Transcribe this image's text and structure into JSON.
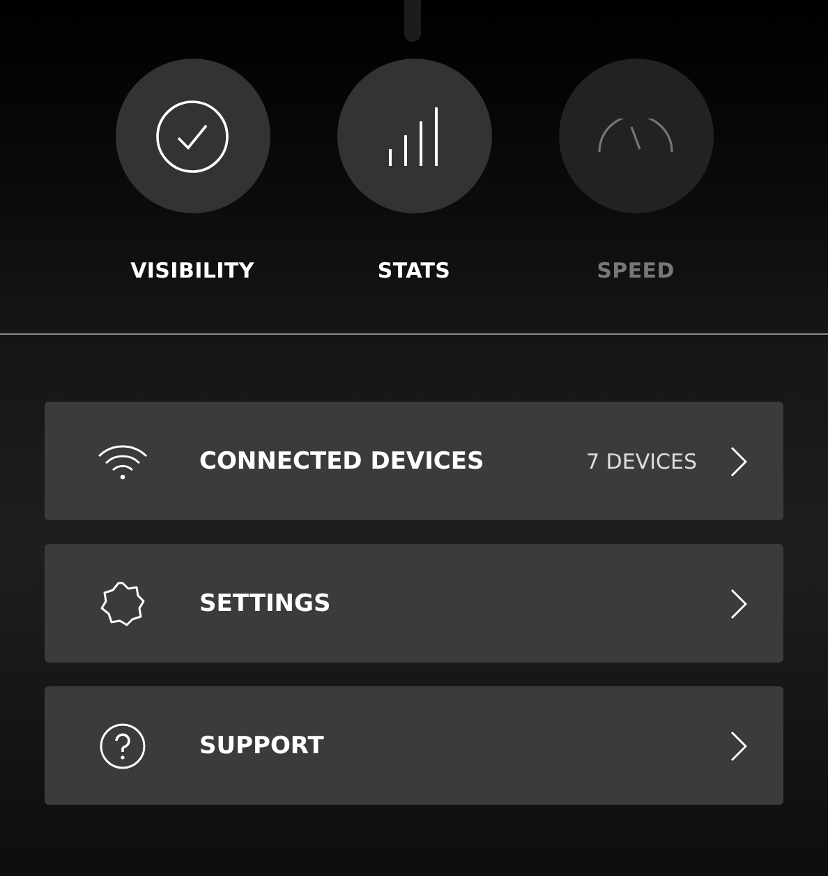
{
  "modes": [
    {
      "label": "VISIBILITY",
      "kind": "check",
      "disabled": false
    },
    {
      "label": "STATS",
      "kind": "bars",
      "disabled": false
    },
    {
      "label": "SPEED",
      "kind": "gauge",
      "disabled": true
    }
  ],
  "menu": [
    {
      "label": "CONNECTED DEVICES",
      "kind": "wifi",
      "detail": "7 DEVICES"
    },
    {
      "label": "SETTINGS",
      "kind": "gear"
    },
    {
      "label": "SUPPORT",
      "kind": "help"
    }
  ]
}
